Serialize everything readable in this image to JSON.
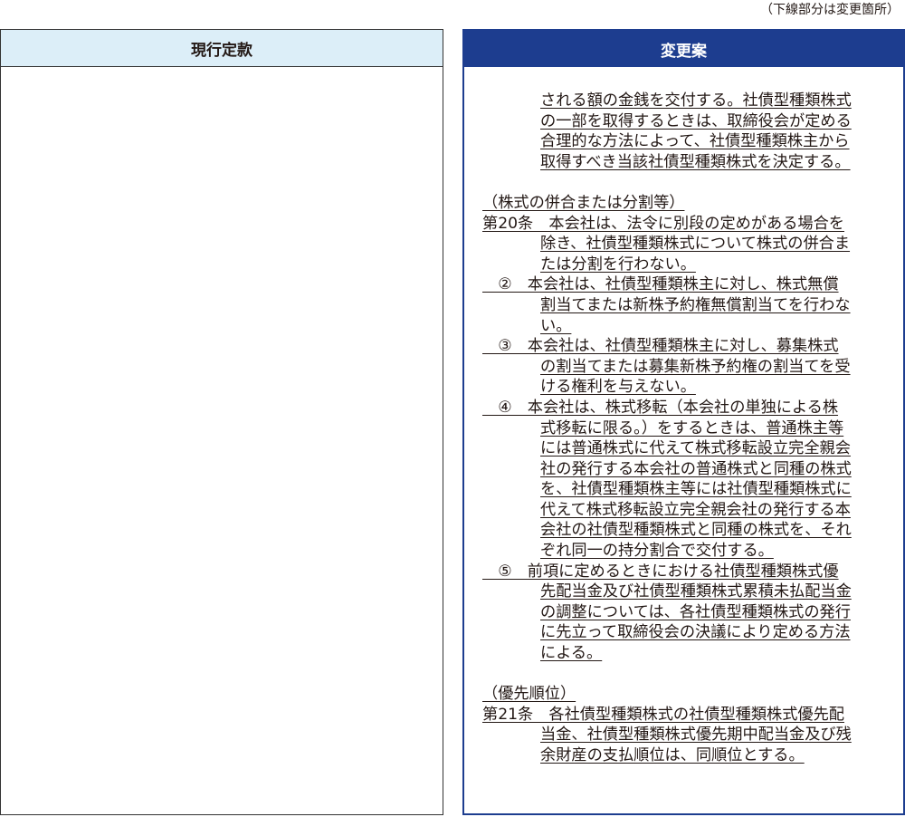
{
  "note": "（下線部分は変更箇所）",
  "left": {
    "title": "現行定款"
  },
  "right": {
    "title": "変更案",
    "lines": [
      {
        "indent": 1,
        "text": "される額の金銭を交付する。社債型種類株式"
      },
      {
        "indent": 1,
        "text": "の一部を取得するときは、取締役会が定める"
      },
      {
        "indent": 1,
        "text": "合理的な方法によって、社債型種類株主から"
      },
      {
        "indent": 1,
        "text": "取得すべき当該社債型種類株式を決定する。"
      },
      {
        "indent": -1,
        "text": ""
      },
      {
        "indent": 0,
        "text": "（株式の併合または分割等）"
      },
      {
        "indent": 0,
        "text": "第20条　本会社は、法令に別段の定めがある場合を"
      },
      {
        "indent": 1,
        "text": "除き、社債型種類株式について株式の併合ま"
      },
      {
        "indent": 1,
        "text": "たは分割を行わない。"
      },
      {
        "indent": 0,
        "text": "　②　本会社は、社債型種類株主に対し、株式無償"
      },
      {
        "indent": 1,
        "text": "割当てまたは新株予約権無償割当てを行わな"
      },
      {
        "indent": 1,
        "text": "い。"
      },
      {
        "indent": 0,
        "text": "　③　本会社は、社債型種類株主に対し、募集株式"
      },
      {
        "indent": 1,
        "text": "の割当てまたは募集新株予約権の割当てを受"
      },
      {
        "indent": 1,
        "text": "ける権利を与えない。"
      },
      {
        "indent": 0,
        "text": "　④　本会社は、株式移転（本会社の単独による株"
      },
      {
        "indent": 1,
        "text": "式移転に限る。）をするときは、普通株主等"
      },
      {
        "indent": 1,
        "text": "には普通株式に代えて株式移転設立完全親会"
      },
      {
        "indent": 1,
        "text": "社の発行する本会社の普通株式と同種の株式"
      },
      {
        "indent": 1,
        "text": "を、社債型種類株主等には社債型種類株式に"
      },
      {
        "indent": 1,
        "text": "代えて株式移転設立完全親会社の発行する本"
      },
      {
        "indent": 1,
        "text": "会社の社債型種類株式と同種の株式を、それ"
      },
      {
        "indent": 1,
        "text": "ぞれ同一の持分割合で交付する。"
      },
      {
        "indent": 0,
        "text": "　⑤　前項に定めるときにおける社債型種類株式優"
      },
      {
        "indent": 1,
        "text": "先配当金及び社債型種類株式累積未払配当金"
      },
      {
        "indent": 1,
        "text": "の調整については、各社債型種類株式の発行"
      },
      {
        "indent": 1,
        "text": "に先立って取締役会の決議により定める方法"
      },
      {
        "indent": 1,
        "text": "による。"
      },
      {
        "indent": -1,
        "text": ""
      },
      {
        "indent": 0,
        "text": "（優先順位）"
      },
      {
        "indent": 0,
        "text": "第21条　各社債型種類株式の社債型種類株式優先配"
      },
      {
        "indent": 1,
        "text": "当金、社債型種類株式優先期中配当金及び残"
      },
      {
        "indent": 1,
        "text": "余財産の支払順位は、同順位とする。"
      }
    ]
  }
}
